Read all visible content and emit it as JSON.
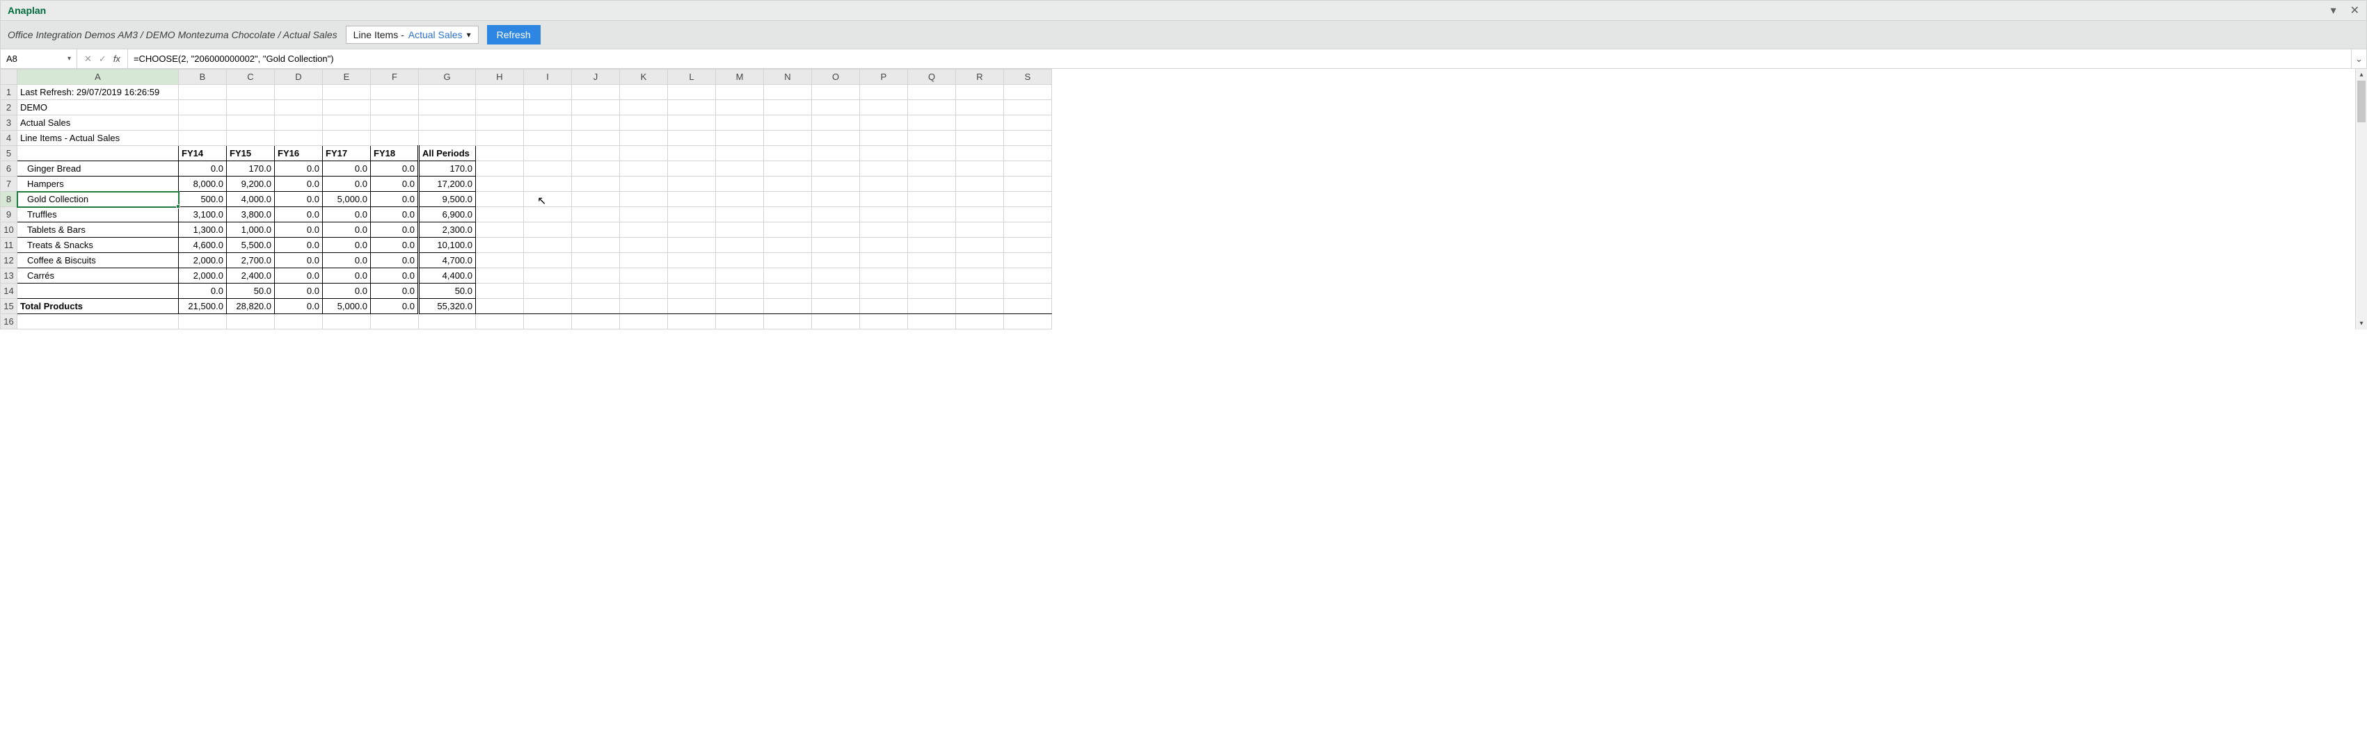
{
  "ribbon": {
    "title": "Anaplan"
  },
  "toolbar": {
    "breadcrumb": "Office Integration Demos AM3 / DEMO Montezuma Chocolate / Actual Sales",
    "dropdown_prefix": "Line Items - ",
    "dropdown_value": "Actual Sales",
    "refresh_label": "Refresh"
  },
  "formula_bar": {
    "cell_ref": "A8",
    "formula": "=CHOOSE(2, \"206000000002\", \"Gold Collection\")"
  },
  "columns": [
    "A",
    "B",
    "C",
    "D",
    "E",
    "F",
    "G",
    "H",
    "I",
    "J",
    "K",
    "L",
    "M",
    "N",
    "O",
    "P",
    "Q",
    "R",
    "S"
  ],
  "meta_rows": {
    "r1": "Last Refresh: 29/07/2019 16:26:59",
    "r2": "DEMO",
    "r3": "Actual Sales",
    "r4": "Line Items - Actual Sales"
  },
  "header_row": [
    "FY14",
    "FY15",
    "FY16",
    "FY17",
    "FY18",
    "All Periods"
  ],
  "data_rows": [
    {
      "label": "Ginger Bread",
      "vals": [
        "0.0",
        "170.0",
        "0.0",
        "0.0",
        "0.0",
        "170.0"
      ]
    },
    {
      "label": "Hampers",
      "vals": [
        "8,000.0",
        "9,200.0",
        "0.0",
        "0.0",
        "0.0",
        "17,200.0"
      ]
    },
    {
      "label": "Gold Collection",
      "vals": [
        "500.0",
        "4,000.0",
        "0.0",
        "5,000.0",
        "0.0",
        "9,500.0"
      ]
    },
    {
      "label": "Truffles",
      "vals": [
        "3,100.0",
        "3,800.0",
        "0.0",
        "0.0",
        "0.0",
        "6,900.0"
      ]
    },
    {
      "label": "Tablets & Bars",
      "vals": [
        "1,300.0",
        "1,000.0",
        "0.0",
        "0.0",
        "0.0",
        "2,300.0"
      ]
    },
    {
      "label": "Treats & Snacks",
      "vals": [
        "4,600.0",
        "5,500.0",
        "0.0",
        "0.0",
        "0.0",
        "10,100.0"
      ]
    },
    {
      "label": "Coffee & Biscuits",
      "vals": [
        "2,000.0",
        "2,700.0",
        "0.0",
        "0.0",
        "0.0",
        "4,700.0"
      ]
    },
    {
      "label": "Carrés",
      "vals": [
        "2,000.0",
        "2,400.0",
        "0.0",
        "0.0",
        "0.0",
        "4,400.0"
      ]
    },
    {
      "label": "",
      "vals": [
        "0.0",
        "50.0",
        "0.0",
        "0.0",
        "0.0",
        "50.0"
      ]
    }
  ],
  "total_row": {
    "label": "Total Products",
    "vals": [
      "21,500.0",
      "28,820.0",
      "0.0",
      "5,000.0",
      "0.0",
      "55,320.0"
    ]
  },
  "chart_data": {
    "type": "table",
    "title": "Actual Sales — Line Items",
    "columns": [
      "FY14",
      "FY15",
      "FY16",
      "FY17",
      "FY18",
      "All Periods"
    ],
    "rows": [
      "Ginger Bread",
      "Hampers",
      "Gold Collection",
      "Truffles",
      "Tablets & Bars",
      "Treats & Snacks",
      "Coffee & Biscuits",
      "Carrés",
      "(blank)",
      "Total Products"
    ],
    "values": [
      [
        0.0,
        170.0,
        0.0,
        0.0,
        0.0,
        170.0
      ],
      [
        8000.0,
        9200.0,
        0.0,
        0.0,
        0.0,
        17200.0
      ],
      [
        500.0,
        4000.0,
        0.0,
        5000.0,
        0.0,
        9500.0
      ],
      [
        3100.0,
        3800.0,
        0.0,
        0.0,
        0.0,
        6900.0
      ],
      [
        1300.0,
        1000.0,
        0.0,
        0.0,
        0.0,
        2300.0
      ],
      [
        4600.0,
        5500.0,
        0.0,
        0.0,
        0.0,
        10100.0
      ],
      [
        2000.0,
        2700.0,
        0.0,
        0.0,
        0.0,
        4700.0
      ],
      [
        2000.0,
        2400.0,
        0.0,
        0.0,
        0.0,
        4400.0
      ],
      [
        0.0,
        50.0,
        0.0,
        0.0,
        0.0,
        50.0
      ],
      [
        21500.0,
        28820.0,
        0.0,
        5000.0,
        0.0,
        55320.0
      ]
    ]
  }
}
